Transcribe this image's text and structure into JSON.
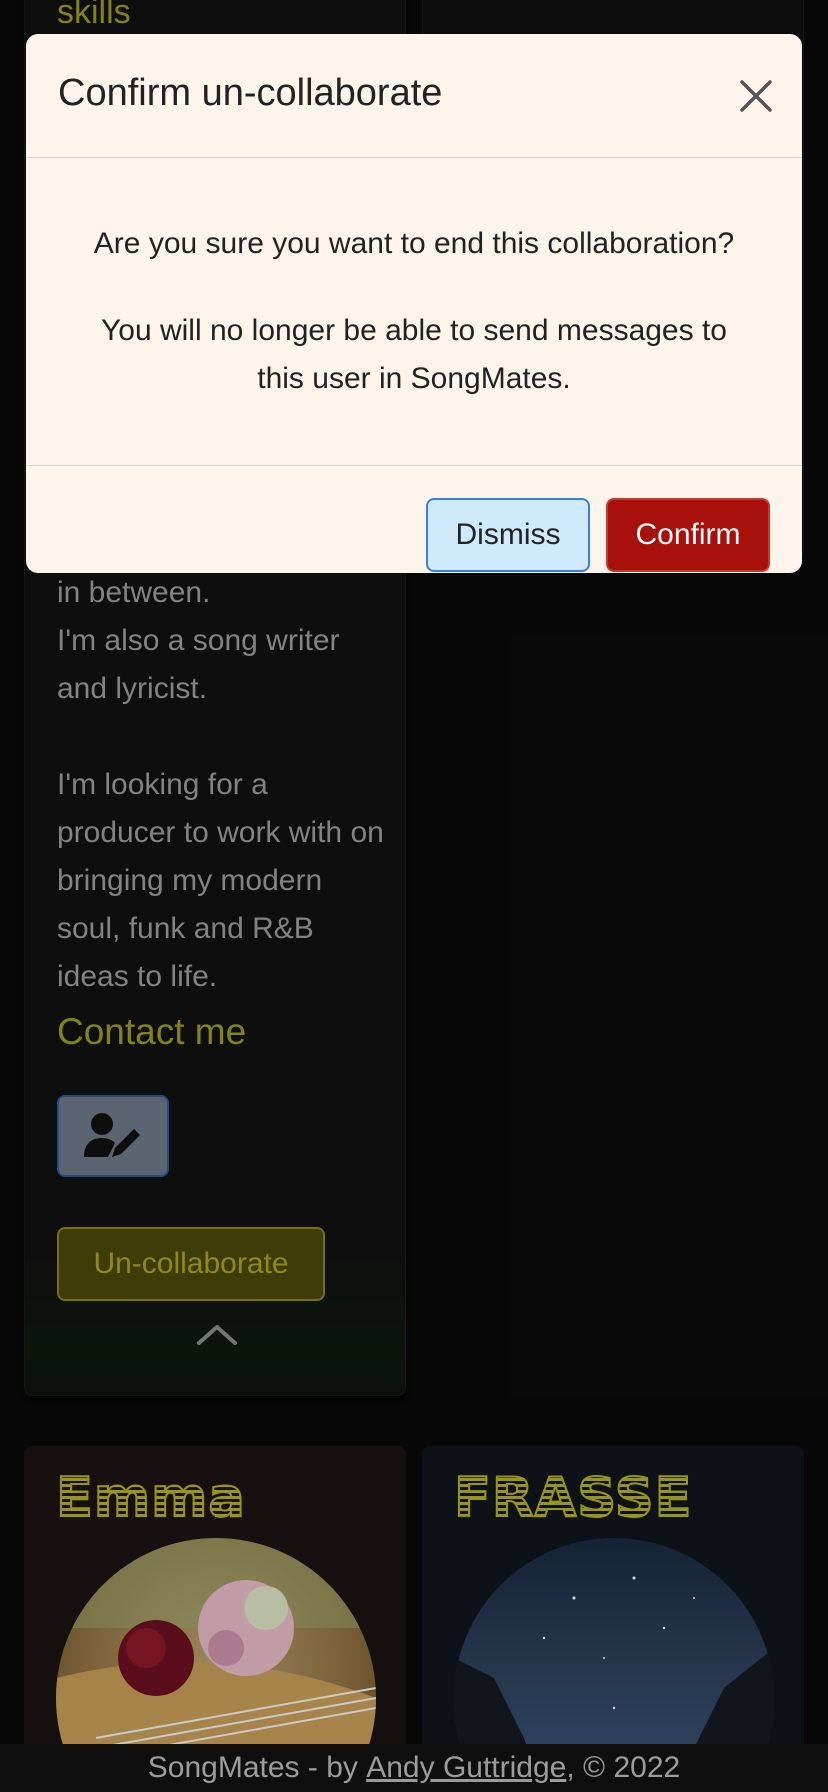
{
  "page": {
    "skills_heading": "skills",
    "bio_text": "in between.\nI'm also a song writer and lyricist.\n\nI'm looking for a producer to work with on bringing my modern soul, funk and R&B ideas to life.",
    "contact_heading": "Contact me",
    "contact_icon": "user-pen-icon",
    "uncollaborate_label": "Un-collaborate",
    "collapse_icon": "chevron-up-icon",
    "profiles": [
      {
        "name": "Emma",
        "image": "guitar-with-flowers-photo"
      },
      {
        "name": "FRASSE",
        "image": "night-sky-sea-rocks-photo"
      }
    ]
  },
  "footer": {
    "prefix": "SongMates - by ",
    "author_link": "Andy Guttridge",
    "suffix": ", © 2022"
  },
  "modal": {
    "title": "Confirm un-collaborate",
    "close_icon": "close-icon",
    "question": "Are you sure you want to end this collaboration?",
    "note": "You will no longer be able to send messages to this user in SongMates.",
    "dismiss_label": "Dismiss",
    "confirm_label": "Confirm"
  },
  "colors": {
    "accent_yellow": "#9a9a1e",
    "confirm_red": "#a8100b",
    "dismiss_blue": "#cfe9fd",
    "modal_bg": "#fdf4ec"
  }
}
